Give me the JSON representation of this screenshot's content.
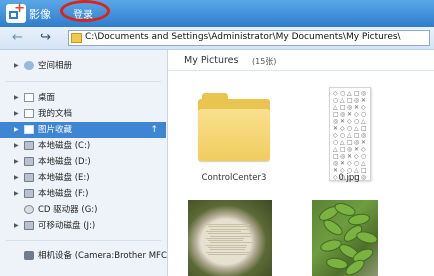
{
  "titlebar": {
    "app_title": "影像",
    "login_label": "登录",
    "logo_icon": "photo-add-icon",
    "brand_color": "#2f7dcc"
  },
  "toolbar": {
    "back_icon": "back-arrow-icon",
    "forward_icon": "forward-arrow-icon",
    "address": "C:\\Documents and Settings\\Administrator\\My Documents\\My Pictures\\"
  },
  "sidebar": {
    "items": [
      {
        "label": "空间相册",
        "icon": "cloud-album-icon"
      },
      {
        "label": "桌面",
        "icon": "desktop-icon"
      },
      {
        "label": "我的文档",
        "icon": "documents-icon"
      },
      {
        "label": "图片收藏",
        "icon": "pictures-icon",
        "selected": true
      },
      {
        "label": "本地磁盘 (C:)",
        "icon": "drive-icon"
      },
      {
        "label": "本地磁盘 (D:)",
        "icon": "drive-icon"
      },
      {
        "label": "本地磁盘 (E:)",
        "icon": "drive-icon"
      },
      {
        "label": "本地磁盘 (F:)",
        "icon": "drive-icon"
      },
      {
        "label": "CD 驱动器 (G:)",
        "icon": "cd-drive-icon"
      },
      {
        "label": "可移动磁盘 (J:)",
        "icon": "removable-drive-icon"
      },
      {
        "label": "相机设备 (Camera:Brother MFC",
        "icon": "camera-icon"
      }
    ],
    "selected_color": "#3e86d4"
  },
  "content": {
    "title": "My Pictures",
    "count": "(15张)",
    "items": [
      {
        "name": "ControlCenter3",
        "type": "folder"
      },
      {
        "name": "0.jpg",
        "type": "image"
      },
      {
        "name": "",
        "type": "image"
      },
      {
        "name": "",
        "type": "image"
      }
    ]
  }
}
